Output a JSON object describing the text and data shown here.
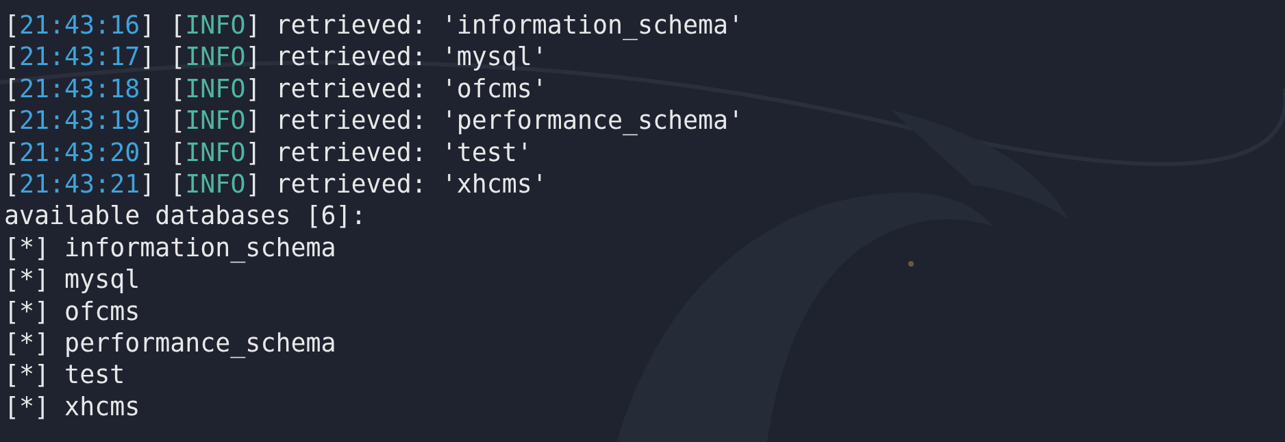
{
  "log": [
    {
      "time": "[21:43:16]",
      "kind": "info",
      "tag": "[INFO]",
      "message": "retrieved: 'information_schema'"
    },
    {
      "time": "[21:43:17]",
      "kind": "info",
      "tag": "[INFO]",
      "message": "retrieved: 'mysql'"
    },
    {
      "time": "[21:43:18]",
      "kind": "info",
      "tag": "[INFO]",
      "message": "retrieved: 'ofcms'"
    },
    {
      "time": "[21:43:19]",
      "kind": "info",
      "tag": "[INFO]",
      "message": "retrieved: 'performance_schema'"
    },
    {
      "time": "[21:43:20]",
      "kind": "info",
      "tag": "[INFO]",
      "message": "retrieved: 'test'"
    },
    {
      "time": "[21:43:21]",
      "kind": "info",
      "tag": "[INFO]",
      "message": "retrieved: 'xhcms'"
    }
  ],
  "heading": "available databases [6]:",
  "databases": [
    {
      "marker": "[*]",
      "name": "information_schema"
    },
    {
      "marker": "[*]",
      "name": "mysql"
    },
    {
      "marker": "[*]",
      "name": "ofcms"
    },
    {
      "marker": "[*]",
      "name": "performance_schema"
    },
    {
      "marker": "[*]",
      "name": "test"
    },
    {
      "marker": "[*]",
      "name": "xhcms"
    }
  ]
}
